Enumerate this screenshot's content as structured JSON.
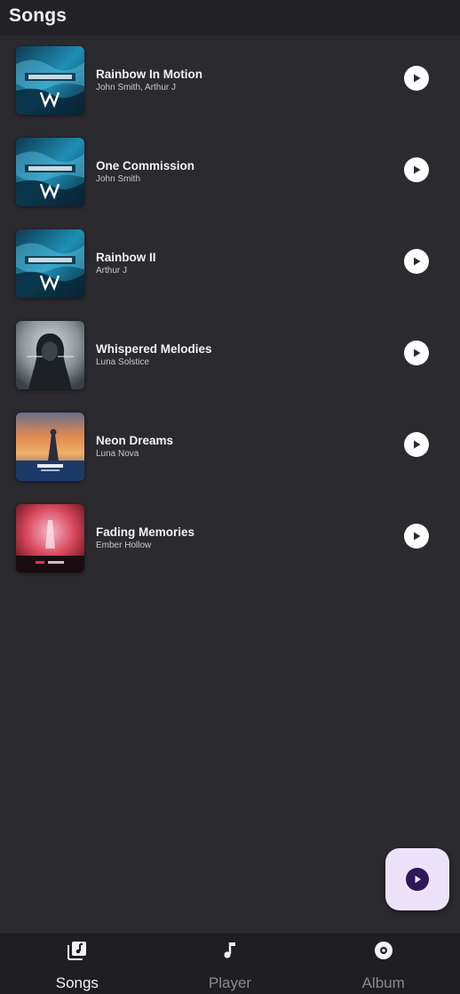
{
  "header": {
    "title": "Songs"
  },
  "songs": [
    {
      "title": "Rainbow In Motion",
      "artist": "John Smith, Arthur J",
      "cover": "alan-walker-blue-cover"
    },
    {
      "title": "One Commission",
      "artist": "John Smith",
      "cover": "alan-walker-blue-cover"
    },
    {
      "title": "Rainbow II",
      "artist": "Arthur J",
      "cover": "alan-walker-blue-cover"
    },
    {
      "title": "Whispered Melodies",
      "artist": "Luna Solstice",
      "cover": "hooded-figure-grey-cover"
    },
    {
      "title": "Neon Dreams",
      "artist": "Luna Nova",
      "cover": "sunset-figure-cover"
    },
    {
      "title": "Fading Memories",
      "artist": "Ember Hollow",
      "cover": "red-pink-cover"
    }
  ],
  "fab": {
    "icon": "play-icon"
  },
  "bottom_nav": {
    "items": [
      {
        "label": "Songs",
        "icon": "music-library-icon",
        "active": true
      },
      {
        "label": "Player",
        "icon": "music-note-icon",
        "active": false
      },
      {
        "label": "Album",
        "icon": "disc-icon",
        "active": false
      }
    ]
  },
  "colors": {
    "background": "#2b2a2f",
    "nav_background": "#1f1e22",
    "fab_background": "#ece3fb",
    "fab_icon": "#2a1a57",
    "text_primary": "#f2f2f6",
    "text_inactive": "#8a8990"
  }
}
